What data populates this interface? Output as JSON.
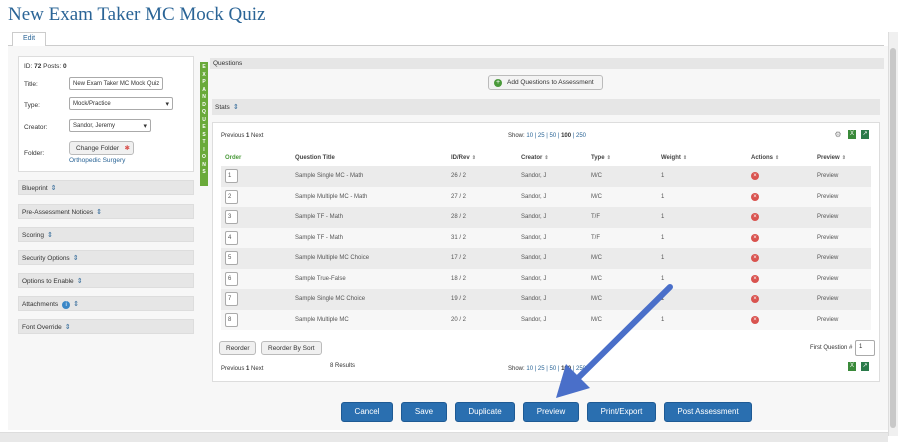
{
  "title": "New Exam Taker MC Mock Quiz",
  "tab": "Edit",
  "details": {
    "id_label": "ID:",
    "id_value": "72",
    "posts_label": "Posts:",
    "posts_value": "0",
    "title_label": "Title:",
    "title_value": "New Exam Taker MC Mock Quiz",
    "type_label": "Type:",
    "type_value": "Mock/Practice",
    "creator_label": "Creator:",
    "creator_value": "Sandor, Jeremy",
    "folder_label": "Folder:",
    "change_folder": "Change Folder",
    "folder_value": "Orthopedic Surgery"
  },
  "sections": [
    "Blueprint",
    "Pre-Assessment Notices",
    "Scoring",
    "Security Options",
    "Options to Enable",
    "Attachments",
    "Font Override"
  ],
  "expand_label": "EXPAND QUESTIONS",
  "questions_header": "Questions",
  "add_questions": "Add Questions to Assessment",
  "stats_label": "Stats",
  "pager": {
    "previous": "Previous",
    "page": "1",
    "next": "Next"
  },
  "show": {
    "label": "Show:",
    "options": "10 | 25 | 50 |",
    "selected": "100",
    "after": "| 250"
  },
  "table": {
    "headers": [
      "Order",
      "Question Title",
      "ID/Rev",
      "Creator",
      "Type",
      "Weight",
      "Actions",
      "Preview"
    ],
    "rows": [
      {
        "order": "1",
        "title": "Sample Single MC - Math",
        "idrev": "26 / 2",
        "creator": "Sandor, J",
        "type": "M/C",
        "weight": "1",
        "preview": "Preview"
      },
      {
        "order": "2",
        "title": "Sample Multiple MC - Math",
        "idrev": "27 / 2",
        "creator": "Sandor, J",
        "type": "M/C",
        "weight": "1",
        "preview": "Preview"
      },
      {
        "order": "3",
        "title": "Sample TF - Math",
        "idrev": "28 / 2",
        "creator": "Sandor, J",
        "type": "T/F",
        "weight": "1",
        "preview": "Preview"
      },
      {
        "order": "4",
        "title": "Sample TF - Math",
        "idrev": "31 / 2",
        "creator": "Sandor, J",
        "type": "T/F",
        "weight": "1",
        "preview": "Preview"
      },
      {
        "order": "5",
        "title": "Sample Multiple MC Choice",
        "idrev": "17 / 2",
        "creator": "Sandor, J",
        "type": "M/C",
        "weight": "1",
        "preview": "Preview"
      },
      {
        "order": "6",
        "title": "Sample True-False",
        "idrev": "18 / 2",
        "creator": "Sandor, J",
        "type": "M/C",
        "weight": "1",
        "preview": "Preview"
      },
      {
        "order": "7",
        "title": "Sample Single MC Choice",
        "idrev": "19 / 2",
        "creator": "Sandor, J",
        "type": "M/C",
        "weight": "1",
        "preview": "Preview"
      },
      {
        "order": "8",
        "title": "Sample Multiple MC",
        "idrev": "20 / 2",
        "creator": "Sandor, J",
        "type": "M/C",
        "weight": "1",
        "preview": "Preview"
      }
    ]
  },
  "reorder": "Reorder",
  "reorder_by_sort": "Reorder By Sort",
  "first_question_label": "First Question #",
  "first_question_value": "1",
  "results": "8 Results",
  "buttons": [
    "Cancel",
    "Save",
    "Duplicate",
    "Preview",
    "Print/Export",
    "Post Assessment"
  ],
  "colors": {
    "primary": "#2a6fb0",
    "arrow": "#4a6fc9",
    "expand": "#6aaa3a",
    "delete": "#d9534f"
  }
}
